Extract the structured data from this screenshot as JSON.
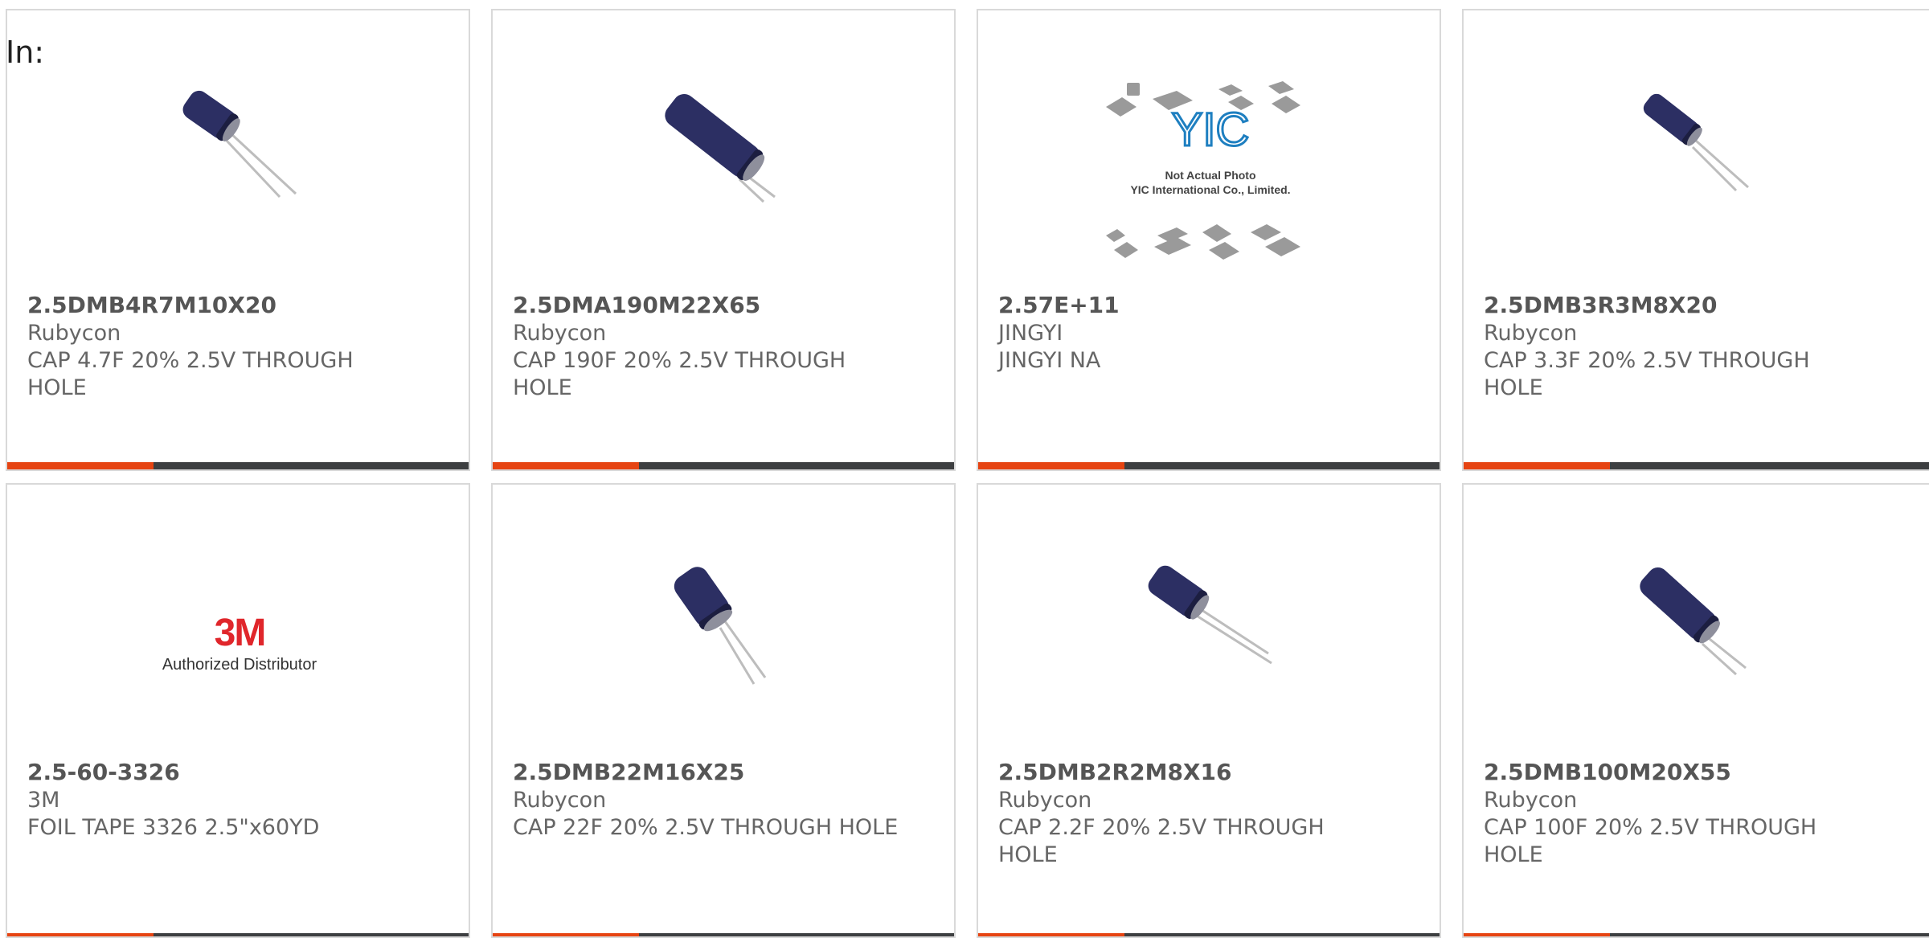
{
  "header": {
    "in_label": "In:"
  },
  "colors": {
    "accent": "#e64412",
    "bar": "#3d3f41",
    "border": "#d9d9d9",
    "text": "#666666",
    "capacitor_body": "#2c2f63"
  },
  "products": [
    {
      "part_number": "2.5DMB4R7M10X20",
      "manufacturer": "Rubycon",
      "description": "CAP 4.7F 20% 2.5V THROUGH HOLE",
      "image": "capacitor-image"
    },
    {
      "part_number": "2.5DMA190M22X65",
      "manufacturer": "Rubycon",
      "description": "CAP 190F 20% 2.5V THROUGH HOLE",
      "image": "capacitor-image"
    },
    {
      "part_number": "2.57E+11",
      "manufacturer": "JINGYI",
      "description": "JINGYI NA",
      "image": "placeholder-image",
      "image_text": {
        "logo": "YIC",
        "line1": "Not Actual Photo",
        "line2": "YIC International Co., Limited."
      }
    },
    {
      "part_number": "2.5DMB3R3M8X20",
      "manufacturer": "Rubycon",
      "description": "CAP 3.3F 20% 2.5V THROUGH HOLE",
      "image": "capacitor-image"
    },
    {
      "part_number": "2.5-60-3326",
      "manufacturer": "3M",
      "description": "FOIL TAPE 3326 2.5\"x60YD",
      "image": "brand-logo",
      "image_text": {
        "logo": "3M",
        "line1": "Authorized Distributor"
      }
    },
    {
      "part_number": "2.5DMB22M16X25",
      "manufacturer": "Rubycon",
      "description": "CAP 22F 20% 2.5V THROUGH HOLE",
      "image": "capacitor-image"
    },
    {
      "part_number": "2.5DMB2R2M8X16",
      "manufacturer": "Rubycon",
      "description": "CAP 2.2F 20% 2.5V THROUGH HOLE",
      "image": "capacitor-image"
    },
    {
      "part_number": "2.5DMB100M20X55",
      "manufacturer": "Rubycon",
      "description": "CAP 100F 20% 2.5V THROUGH HOLE",
      "image": "capacitor-image"
    }
  ]
}
